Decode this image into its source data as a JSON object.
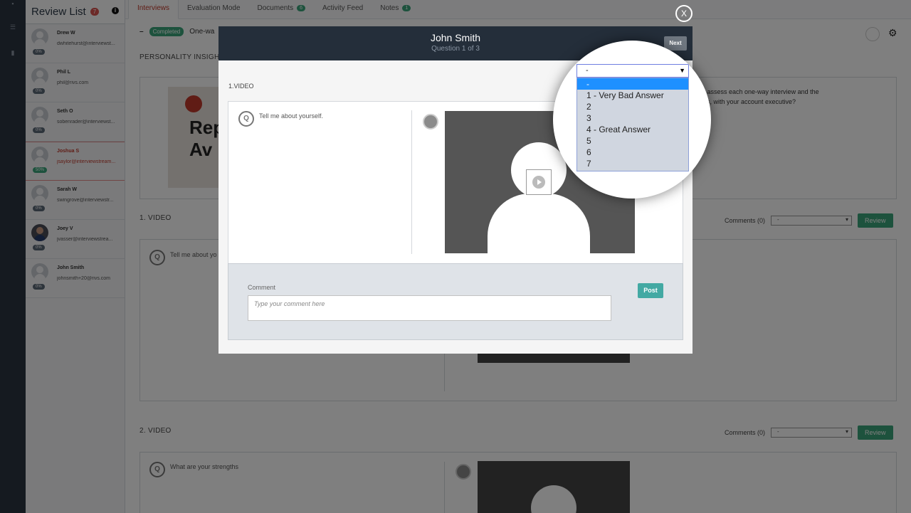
{
  "sidebar": {
    "title": "Review List",
    "count": "7",
    "info_icon": "i",
    "candidates": [
      {
        "name": "Drew W",
        "email": "dwhitehurst@interviewst...",
        "pct": "0%",
        "selected": false
      },
      {
        "name": "Phil L",
        "email": "phil@rivs.com",
        "pct": "0%",
        "selected": false
      },
      {
        "name": "Seth O",
        "email": "sobenrader@interviewst...",
        "pct": "0%",
        "selected": false
      },
      {
        "name": "Joshua S",
        "email": "jsaylor@interviewstream...",
        "pct": "50%",
        "selected": true
      },
      {
        "name": "Sarah W",
        "email": "swingrove@interviewstr...",
        "pct": "0%",
        "selected": false
      },
      {
        "name": "Joey V",
        "email": "jvasser@interviewstrea...",
        "pct": "0%",
        "selected": false
      },
      {
        "name": "John Smith",
        "email": "johnsmith+20@rivs.com",
        "pct": "0%",
        "selected": false
      }
    ]
  },
  "tabs": [
    {
      "label": "Interviews",
      "badge": ""
    },
    {
      "label": "Evaluation Mode",
      "badge": ""
    },
    {
      "label": "Documents",
      "badge": "6"
    },
    {
      "label": "Activity Feed",
      "badge": ""
    },
    {
      "label": "Notes",
      "badge": "1"
    }
  ],
  "main": {
    "status_dash": "–",
    "status": "Completed",
    "interview_type": "One-wa",
    "insights_title": "PERSONALITY INSIGHTS",
    "insights_text_1": "u assess each one-way interview and the",
    "insights_text_2": "fits, with your account executive?",
    "insight_image_text": "Rep",
    "insight_image_text_2": "Av",
    "q1_title": "1. VIDEO",
    "q1_question": "Tell me about yo",
    "q2_title": "2. VIDEO",
    "q2_question": "What are your strengths",
    "comments_label": "Comments (0)",
    "select_value": "-",
    "review_label": "Review"
  },
  "modal": {
    "close_label": "X",
    "name": "John Smith",
    "subtitle": "Question 1 of 3",
    "next_label": "Next",
    "section_label": "1.VIDEO",
    "question_icon": "Q",
    "question": "Tell me about yourself.",
    "comment_label": "Comment",
    "comment_placeholder": "Type your comment here",
    "post_label": "Post"
  },
  "rating": {
    "selected": "-",
    "options": [
      "-",
      "1 - Very Bad Answer",
      "2",
      "3",
      "4 - Great Answer",
      "5",
      "6",
      "7"
    ]
  }
}
